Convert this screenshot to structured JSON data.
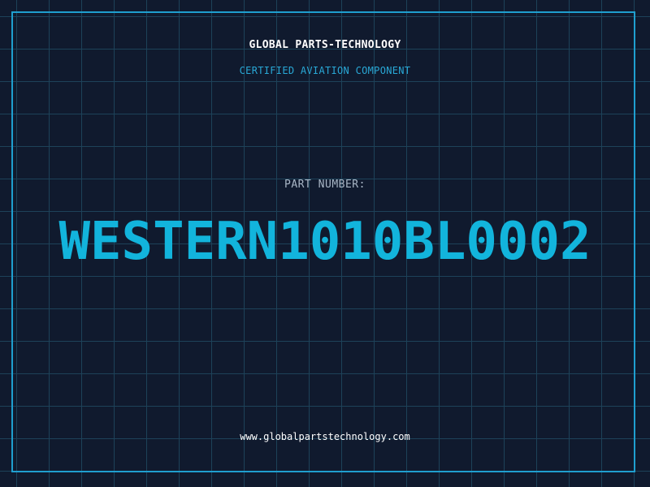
{
  "header": {
    "company": "GLOBAL PARTS-TECHNOLOGY",
    "subtitle": "CERTIFIED AVIATION COMPONENT"
  },
  "part": {
    "label": "PART NUMBER:",
    "number": "WESTERN1010BL0002"
  },
  "footer": {
    "website": "www.globalpartstechnology.com"
  },
  "colors": {
    "background": "#101a2e",
    "grid": "#1d4259",
    "accent": "#12b4dc",
    "frame": "#1f9fcf"
  }
}
